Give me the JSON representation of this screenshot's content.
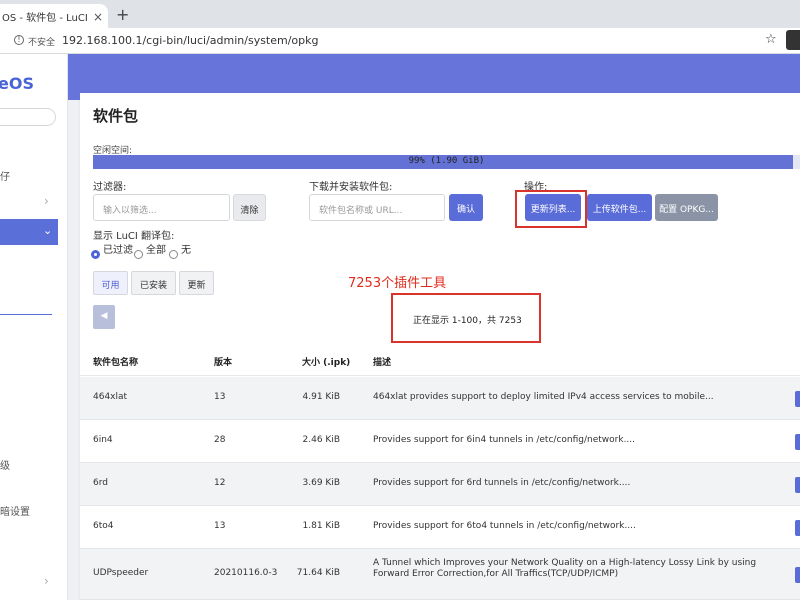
{
  "browser": {
    "tab_title": "OS - 软件包 - LuCI",
    "tab_close": "×",
    "new_tab": "+",
    "security_label": "不安全",
    "url": "192.168.100.1/cgi-bin/luci/admin/system/opkg"
  },
  "sidebar": {
    "brand": "eOS",
    "items": [
      {
        "label": "仔"
      },
      {
        "label": "级"
      },
      {
        "label": "暗设置"
      }
    ]
  },
  "page": {
    "title": "软件包",
    "free_space_label": "空闲空间:",
    "free_space_text": "99% (1.90 GiB)",
    "free_space_percent": 99,
    "filter_label": "过滤器:",
    "filter_placeholder": "输入以筛选...",
    "clear_button": "清除",
    "download_label": "下载并安装软件包:",
    "download_placeholder": "软件包名称或 URL...",
    "confirm_button": "确认",
    "actions_label": "操作:",
    "update_lists_button": "更新列表...",
    "upload_button": "上传软件包...",
    "configure_button": "配置 OPKG...",
    "translations_label": "显示 LuCI 翻译包:",
    "radio_filtered": "已过滤",
    "radio_all": "全部",
    "radio_none": "无",
    "tab_available": "可用",
    "tab_installed": "已安装",
    "tab_updates": "更新",
    "pager_prev": "◀",
    "annotation": "7253个插件工具",
    "pager_text": "正在显示 1-100，共 7253"
  },
  "table": {
    "headers": [
      "软件包名称",
      "版本",
      "大小 (.ipk)",
      "描述"
    ],
    "rows": [
      {
        "name": "464xlat",
        "version": "13",
        "size": "4.91 KiB",
        "desc": "464xlat provides support to deploy limited IPv4 access services to mobile..."
      },
      {
        "name": "6in4",
        "version": "28",
        "size": "2.46 KiB",
        "desc": "Provides support for 6in4 tunnels in /etc/config/network...."
      },
      {
        "name": "6rd",
        "version": "12",
        "size": "3.69 KiB",
        "desc": "Provides support for 6rd tunnels in /etc/config/network...."
      },
      {
        "name": "6to4",
        "version": "13",
        "size": "1.81 KiB",
        "desc": "Provides support for 6to4 tunnels in /etc/config/network...."
      },
      {
        "name": "UDPspeeder",
        "version": "20210116.0-3",
        "size": "71.64 KiB",
        "desc": "A Tunnel which Improves your Network Quality on a High-latency Lossy Link by using Forward Error Correction,for All Traffics(TCP/UDP/ICMP)"
      }
    ]
  },
  "colors": {
    "accent": "#5a6cd8",
    "header_band": "#6775db",
    "annotation_red": "#d9342b"
  }
}
